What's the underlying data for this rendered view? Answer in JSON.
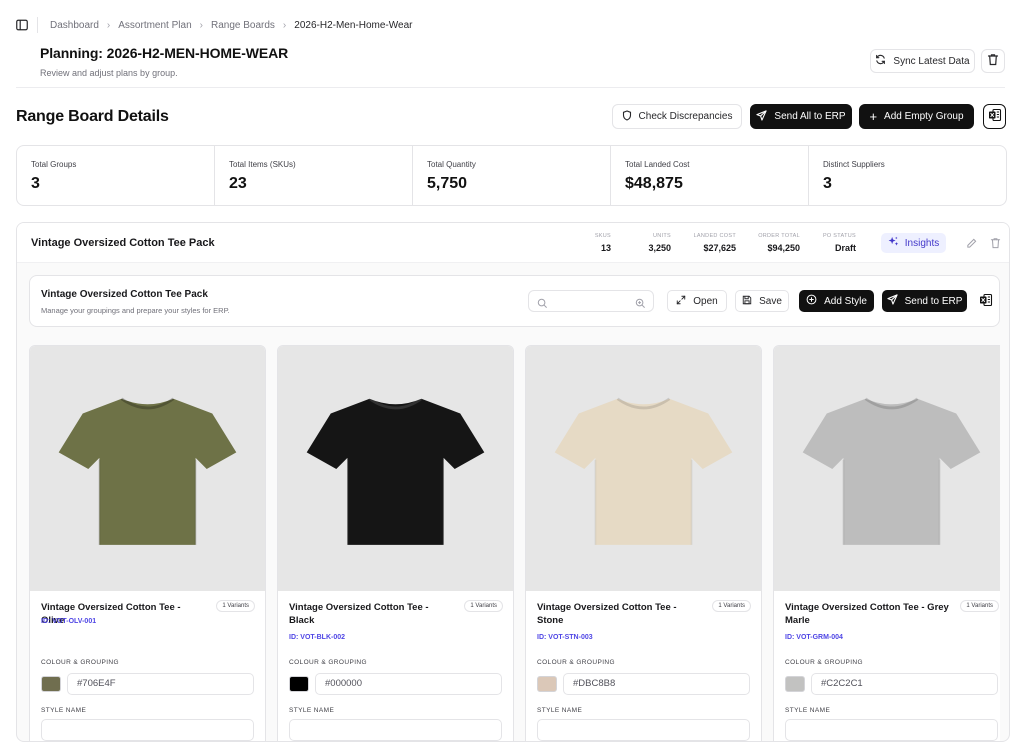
{
  "breadcrumb": [
    "Dashboard",
    "Assortment Plan",
    "Range Boards",
    "2026-H2-Men-Home-Wear"
  ],
  "page": {
    "title": "Planning: 2026-H2-MEN-HOME-WEAR",
    "subtitle": "Review and adjust plans by group.",
    "sync_label": "Sync Latest Data"
  },
  "section": {
    "title": "Range Board Details",
    "check_label": "Check Discrepancies",
    "send_all_label": "Send All to ERP",
    "add_group_label": "Add Empty Group"
  },
  "stats": [
    {
      "label": "Total Groups",
      "value": "3"
    },
    {
      "label": "Total Items (SKUs)",
      "value": "23"
    },
    {
      "label": "Total Quantity",
      "value": "5,750"
    },
    {
      "label": "Total Landed Cost",
      "value": "$48,875"
    },
    {
      "label": "Distinct Suppliers",
      "value": "3"
    }
  ],
  "group": {
    "name": "Vintage Oversized Cotton Tee Pack",
    "metrics": [
      {
        "label": "SKUS",
        "value": "13"
      },
      {
        "label": "UNITS",
        "value": "3,250"
      },
      {
        "label": "LANDED COST",
        "value": "$27,625"
      },
      {
        "label": "ORDER TOTAL",
        "value": "$94,250"
      },
      {
        "label": "PO STATUS",
        "value": "Draft"
      }
    ],
    "insights_label": "Insights",
    "sub": {
      "title": "Vintage Oversized Cotton Tee Pack",
      "subtitle": "Manage your groupings and prepare your styles for ERP.",
      "search_placeholder": "",
      "open_label": "Open",
      "save_label": "Save",
      "add_style_label": "Add Style",
      "send_label": "Send to ERP"
    },
    "colour_label": "COLOUR & GROUPING",
    "style_label": "STYLE NAME",
    "products": [
      {
        "name": "Vintage Oversized Cotton Tee - Olive",
        "variants": "1 Variants",
        "id": "ID: VOT-OLV-001",
        "colour": "#706E4F",
        "swatch": "#706E4F",
        "shirt": "#6e7247"
      },
      {
        "name": "Vintage Oversized Cotton Tee - Black",
        "variants": "1 Variants",
        "id": "ID: VOT-BLK-002",
        "colour": "#000000",
        "swatch": "#000000",
        "shirt": "#151515"
      },
      {
        "name": "Vintage Oversized Cotton Tee - Stone",
        "variants": "1 Variants",
        "id": "ID: VOT-STN-003",
        "colour": "#DBC8B8",
        "swatch": "#DBC8B8",
        "shirt": "#e6dac5"
      },
      {
        "name": "Vintage Oversized Cotton Tee - Grey Marle",
        "variants": "1 Variants",
        "id": "ID: VOT-GRM-004",
        "colour": "#C2C2C1",
        "swatch": "#C2C2C1",
        "shirt": "#bdbdbd"
      }
    ]
  }
}
